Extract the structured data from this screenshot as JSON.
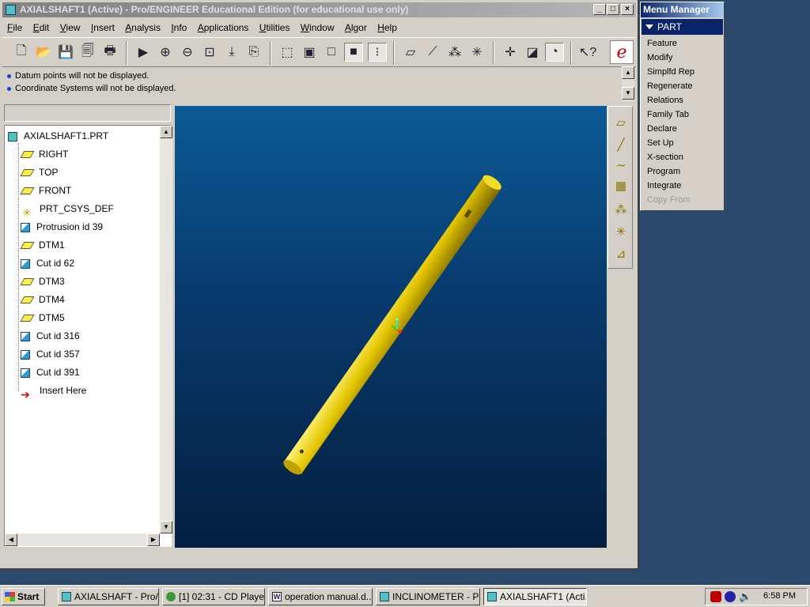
{
  "window": {
    "title": "AXIALSHAFT1 (Active) - Pro/ENGINEER Educational Edition (for educational use only)",
    "controls": {
      "minimize": "_",
      "maximize": "□",
      "close": "×"
    }
  },
  "menubar": [
    "File",
    "Edit",
    "View",
    "Insert",
    "Analysis",
    "Info",
    "Applications",
    "Utilities",
    "Window",
    "Algor",
    "Help"
  ],
  "messages": [
    "Datum points will not be displayed.",
    "Coordinate Systems will not be displayed."
  ],
  "tree": {
    "root": "AXIALSHAFT1.PRT",
    "items": [
      {
        "label": "RIGHT",
        "icon": "datum-plane-icon"
      },
      {
        "label": "TOP",
        "icon": "datum-plane-icon"
      },
      {
        "label": "FRONT",
        "icon": "datum-plane-icon"
      },
      {
        "label": "PRT_CSYS_DEF",
        "icon": "csys-icon"
      },
      {
        "label": "Protrusion id 39",
        "icon": "feature-icon"
      },
      {
        "label": "DTM1",
        "icon": "datum-plane-icon"
      },
      {
        "label": "Cut id 62",
        "icon": "feature-icon"
      },
      {
        "label": "DTM3",
        "icon": "datum-plane-icon"
      },
      {
        "label": "DTM4",
        "icon": "datum-plane-icon"
      },
      {
        "label": "DTM5",
        "icon": "datum-plane-icon"
      },
      {
        "label": "Cut id 316",
        "icon": "feature-icon"
      },
      {
        "label": "Cut id 357",
        "icon": "feature-icon"
      },
      {
        "label": "Cut id 391",
        "icon": "feature-icon"
      },
      {
        "label": "Insert Here",
        "icon": "insert-arrow-icon"
      }
    ]
  },
  "menu_manager": {
    "title": "Menu Manager",
    "panel": "PART",
    "items": [
      {
        "label": "Feature",
        "enabled": true
      },
      {
        "label": "Modify",
        "enabled": true
      },
      {
        "label": "Simplfd Rep",
        "enabled": true
      },
      {
        "label": "Regenerate",
        "enabled": true
      },
      {
        "label": "Relations",
        "enabled": true
      },
      {
        "label": "Family Tab",
        "enabled": true
      },
      {
        "label": "Declare",
        "enabled": true
      },
      {
        "label": "Set Up",
        "enabled": true
      },
      {
        "label": "X-section",
        "enabled": true
      },
      {
        "label": "Program",
        "enabled": true
      },
      {
        "label": "Integrate",
        "enabled": true
      },
      {
        "label": "Copy From",
        "enabled": false
      }
    ]
  },
  "taskbar": {
    "start": "Start",
    "tasks": [
      "AXIALSHAFT - Pro/...",
      "[1] 02:31 - CD Player",
      "operation manual.d...",
      "INCLINOMETER - Pr...",
      "AXIALSHAFT1 (Acti..."
    ],
    "clock": "6:58 PM"
  },
  "colors": {
    "viewport_top": "#0b5a96",
    "viewport_bottom": "#041f3f",
    "shaft": "#e3c500",
    "menu_manager_title": "#0a246a"
  }
}
